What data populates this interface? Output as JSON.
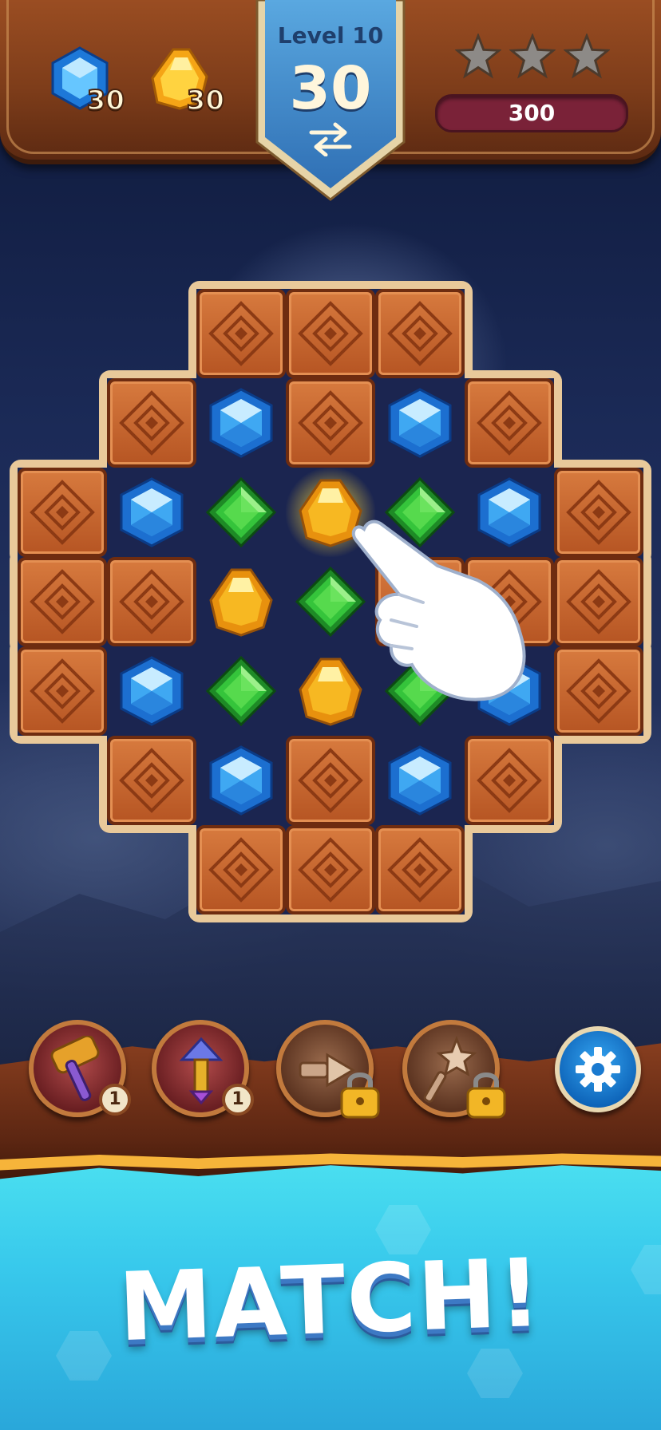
{
  "hud": {
    "goals": [
      {
        "gem": "blue-gem-icon",
        "count": "30"
      },
      {
        "gem": "yellow-gem-icon",
        "count": "30"
      }
    ],
    "level_label": "Level 10",
    "moves_left": "30",
    "stars_earned": 0,
    "stars_total": 3,
    "score": "300"
  },
  "board": {
    "rows": [
      "..CCC..",
      ".CBCBC.",
      "CBGYGBC",
      "CCYGCCC",
      "CBGYGBC",
      ".CBCBC.",
      "..CCC.."
    ],
    "legend": {
      "C": "wooden-crate",
      "B": "blue-gem",
      "Y": "yellow-gem",
      "G": "green-gem"
    },
    "highlighted_cell": {
      "row": 2,
      "col": 3
    }
  },
  "boosters": [
    {
      "name": "hammer-booster",
      "icon": "hammer-icon",
      "count": "1",
      "locked": false
    },
    {
      "name": "arrow-booster",
      "icon": "arrow-icon",
      "count": "1",
      "locked": false
    },
    {
      "name": "drill-booster",
      "icon": "drill-icon",
      "locked": true
    },
    {
      "name": "star-wand-booster",
      "icon": "star-wand-icon",
      "locked": true
    }
  ],
  "settings": {
    "icon": "gear-icon"
  },
  "banner": {
    "text": "MATCH!"
  },
  "colors": {
    "blue_gem": "#3fa8f2",
    "yellow_gem": "#f7b822",
    "green_gem": "#35c43b",
    "crate": "#c9662d",
    "score_bar": "#7a2238"
  }
}
